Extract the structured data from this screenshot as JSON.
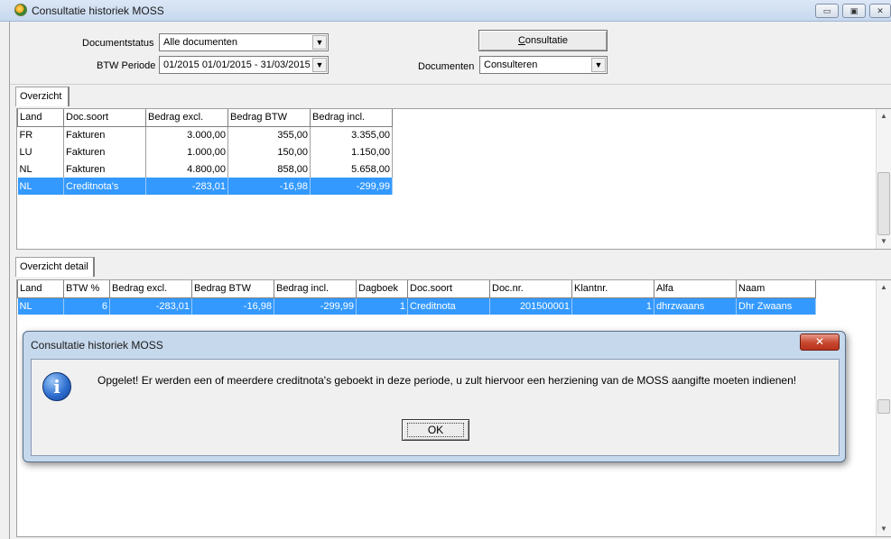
{
  "window": {
    "title": "Consultatie historiek MOSS",
    "minimize_glyph": "▭",
    "maximize_glyph": "▣",
    "close_glyph": "✕"
  },
  "filters": {
    "documentstatus_label": "Documentstatus",
    "documentstatus_value": "Alle documenten",
    "btw_periode_label": "BTW Periode",
    "btw_periode_value": "01/2015   01/01/2015 - 31/03/2015",
    "documenten_label": "Documenten",
    "documenten_value": "Consulteren",
    "consultatie_button_accel": "C",
    "consultatie_button_rest": "onsultatie"
  },
  "overzicht": {
    "tab_label": "Overzicht",
    "columns": [
      "Land",
      "Doc.soort",
      "Bedrag excl.",
      "Bedrag BTW",
      "Bedrag incl."
    ],
    "rows": [
      [
        "FR",
        "Fakturen",
        "3.000,00",
        "355,00",
        "3.355,00"
      ],
      [
        "LU",
        "Fakturen",
        "1.000,00",
        "150,00",
        "1.150,00"
      ],
      [
        "NL",
        "Fakturen",
        "4.800,00",
        "858,00",
        "5.658,00"
      ],
      [
        "NL",
        "Creditnota's",
        "-283,01",
        "-16,98",
        "-299,99"
      ]
    ]
  },
  "detail": {
    "tab_label": "Overzicht detail",
    "columns": [
      "Land",
      "BTW %",
      "Bedrag excl.",
      "Bedrag BTW",
      "Bedrag incl.",
      "Dagboek",
      "Doc.soort",
      "Doc.nr.",
      "Klantnr.",
      "Alfa",
      "Naam"
    ],
    "rows": [
      [
        "NL",
        "6",
        "-283,01",
        "-16,98",
        "-299,99",
        "1",
        "Creditnota",
        "201500001",
        "1",
        "dhrzwaans",
        "Dhr Zwaans"
      ]
    ]
  },
  "dialog": {
    "title": "Consultatie historiek MOSS",
    "close_glyph": "✕",
    "icon_glyph": "i",
    "message": "Opgelet! Er werden een of meerdere creditnota's geboekt in deze periode, u zult hiervoor een herziening van de MOSS aangifte moeten indienen!",
    "ok_label": "OK"
  },
  "colors": {
    "selection": "#3399ff",
    "dialog_frame": "#c6d8ec",
    "close_red": "#c7462e"
  }
}
